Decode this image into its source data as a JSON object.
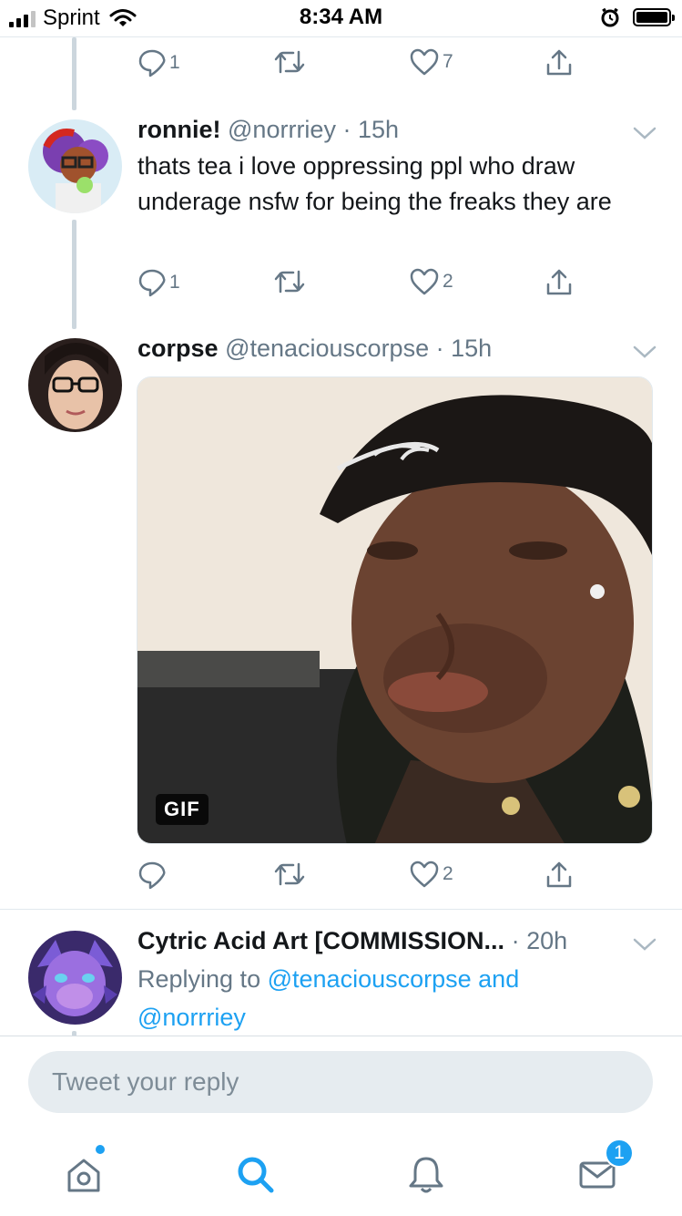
{
  "status_bar": {
    "carrier": "Sprint",
    "time": "8:34 AM"
  },
  "colors": {
    "accent": "#1da1f2",
    "text": "#14171a",
    "muted": "#657786",
    "divider": "#e1e8ed"
  },
  "top_tweet_actions": {
    "reply_count": "1",
    "like_count": "7"
  },
  "tweets": [
    {
      "name": "ronnie!",
      "handle": "@norrriey",
      "dot": "·",
      "time": "15h",
      "text": "thats tea i love oppressing ppl who draw underage nsfw for being the freaks they are",
      "reply_count": "1",
      "retweet_count": "",
      "like_count": "2"
    },
    {
      "name": "corpse",
      "handle": "@tenaciouscorpse",
      "dot": "·",
      "time": "15h",
      "media_badge": "GIF",
      "reply_count": "",
      "retweet_count": "",
      "like_count": "2"
    },
    {
      "name": "Cytric Acid Art [COMMISSION...",
      "dot": "·",
      "time": "20h",
      "replying_prefix": "Replying to",
      "replying_user1": "@tenaciouscorpse",
      "replying_and": "and",
      "replying_user2": "@norrriey"
    }
  ],
  "reply_box": {
    "placeholder": "Tweet your reply"
  },
  "tab_bar": {
    "items": [
      {
        "icon": "home-icon"
      },
      {
        "icon": "search-icon"
      },
      {
        "icon": "bell-icon"
      },
      {
        "icon": "mail-icon"
      }
    ],
    "messages_badge": "1"
  }
}
